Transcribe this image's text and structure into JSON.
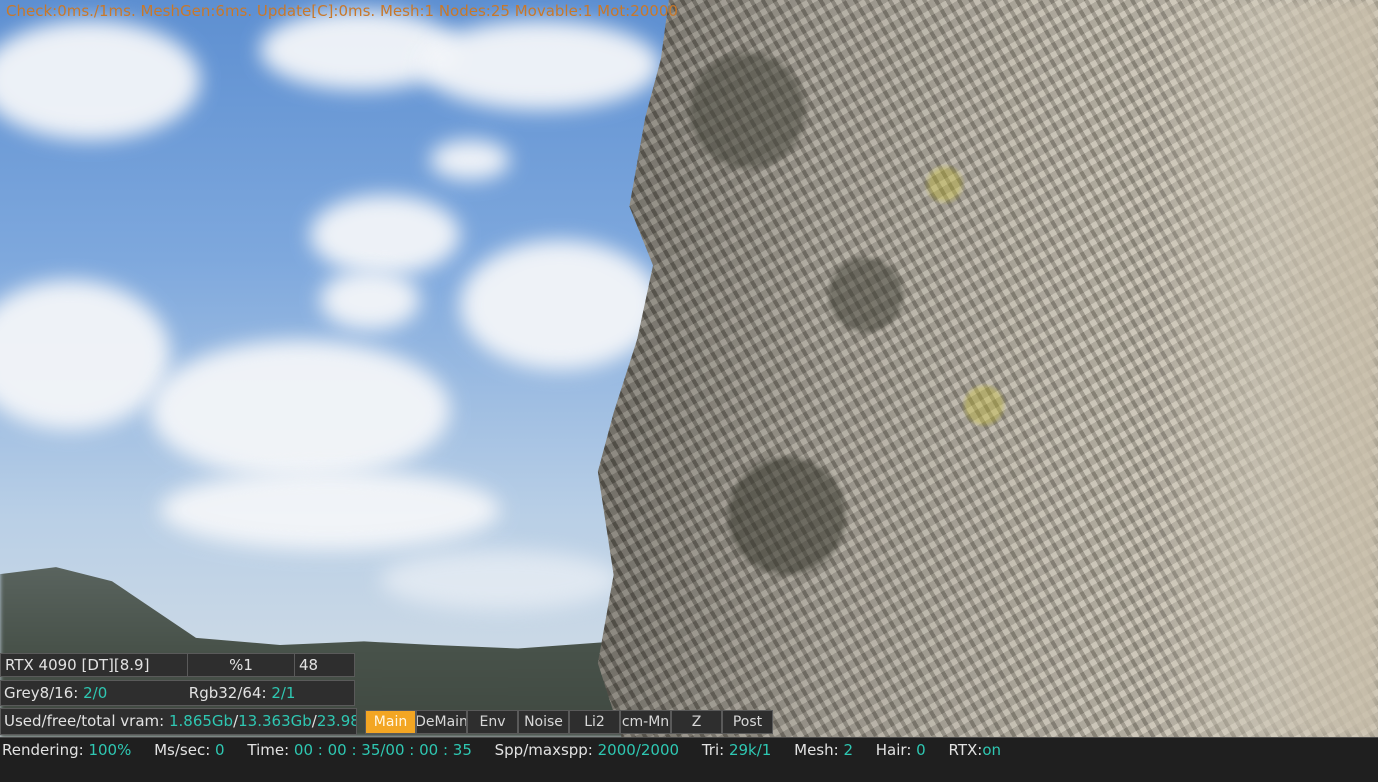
{
  "overlay": {
    "stats_line": "Check:0ms./1ms. MeshGen:6ms. Update[C]:0ms. Mesh:1 Nodes:25 Movable:1 Mot:20000"
  },
  "info_panel": {
    "gpu": "RTX 4090 [DT][8.9]",
    "percent": "%1",
    "count": "48",
    "grey_label": "Grey8/16:",
    "grey_value": "2/0",
    "rgb_label": "Rgb32/64:",
    "rgb_value": "2/1",
    "vram_label": "Used/free/total vram:",
    "vram_used": "1.865Gb",
    "vram_free": "13.363Gb",
    "vram_total": "23.98"
  },
  "tabs": [
    {
      "label": "Main",
      "active": true
    },
    {
      "label": "DeMain",
      "active": false
    },
    {
      "label": "Env",
      "active": false
    },
    {
      "label": "Noise",
      "active": false
    },
    {
      "label": "Li2",
      "active": false
    },
    {
      "label": "cm-Mn",
      "active": false
    },
    {
      "label": "Z",
      "active": false
    },
    {
      "label": "Post",
      "active": false
    }
  ],
  "status": {
    "rendering_label": "Rendering:",
    "rendering_value": "100%",
    "ms_label": "Ms/sec:",
    "ms_value": "0",
    "time_label": "Time:",
    "time_value": "00 : 00 : 35/00 : 00 : 35",
    "spp_label": "Spp/maxspp:",
    "spp_value": "2000/2000",
    "tri_label": "Tri:",
    "tri_value": "29k/1",
    "mesh_label": "Mesh:",
    "mesh_value": "2",
    "hair_label": "Hair:",
    "hair_value": "0",
    "rtx_label": "RTX:",
    "rtx_value": "on"
  },
  "colors": {
    "accent_tab": "#f3a623",
    "value_teal": "#2ec7b2",
    "stats_orange": "#c8782a"
  }
}
